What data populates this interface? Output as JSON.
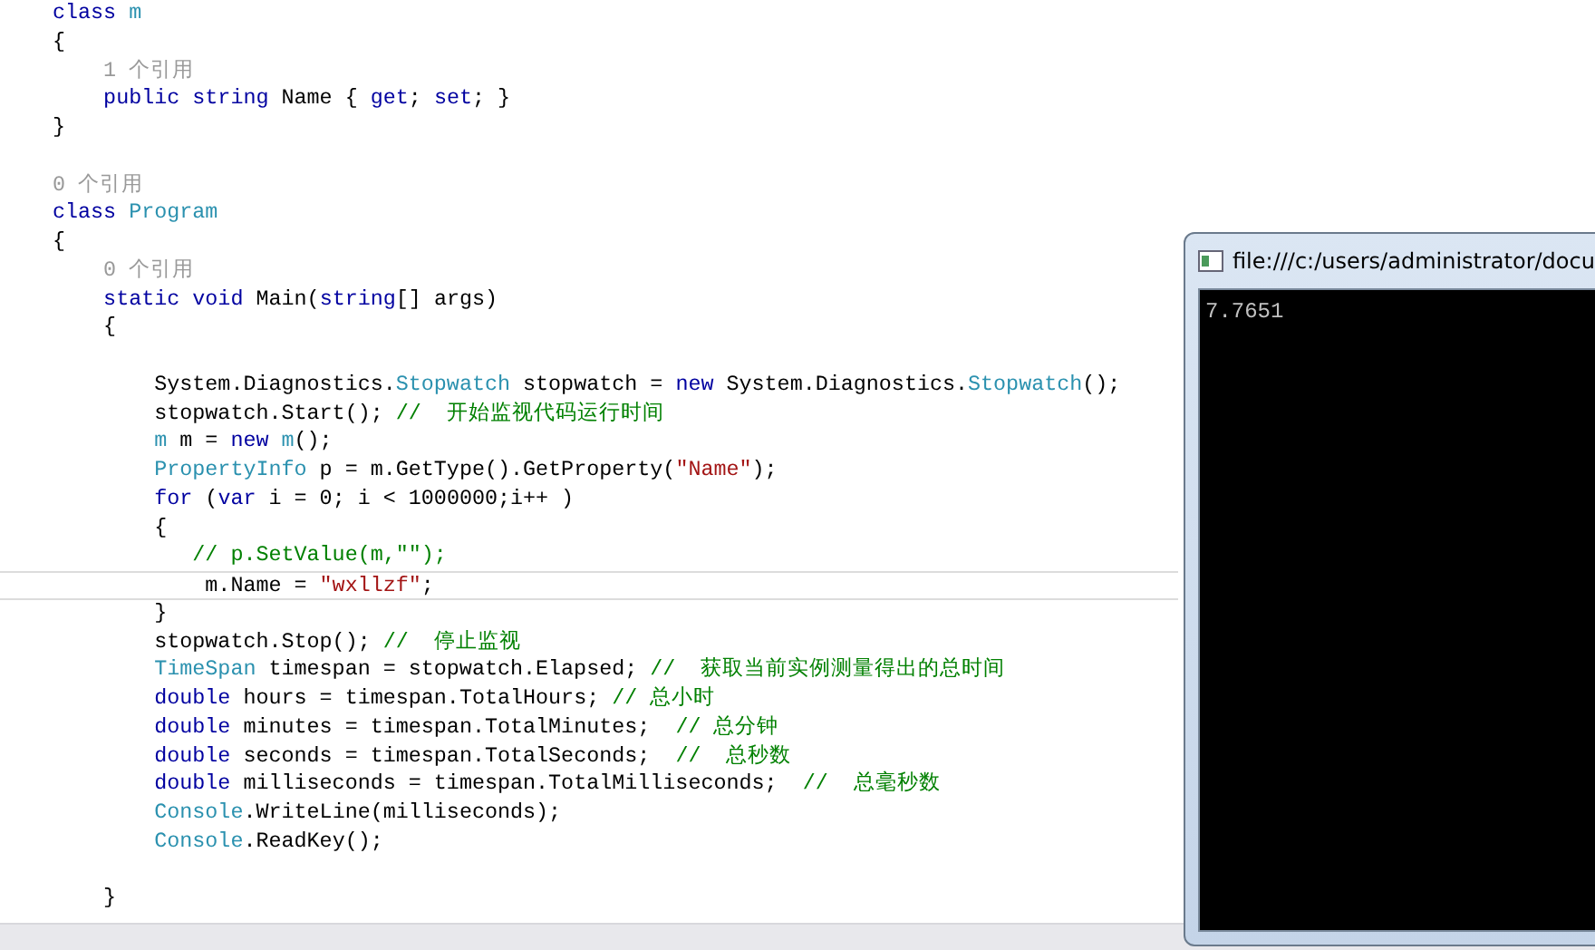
{
  "editor": {
    "lines": [
      {
        "current": false,
        "tokens": [
          {
            "kind": "keyword",
            "text": "class"
          },
          {
            "kind": "type",
            "text": " m"
          }
        ]
      },
      {
        "current": false,
        "tokens": [
          {
            "kind": "plain",
            "text": "{"
          }
        ]
      },
      {
        "current": false,
        "tokens": [
          {
            "kind": "reference",
            "text": "    1 个引用"
          }
        ]
      },
      {
        "current": false,
        "tokens": [
          {
            "kind": "keyword",
            "text": "    public"
          },
          {
            "kind": "keyword",
            "text": " string"
          },
          {
            "kind": "plain",
            "text": " Name { "
          },
          {
            "kind": "keyword",
            "text": "get"
          },
          {
            "kind": "plain",
            "text": "; "
          },
          {
            "kind": "keyword",
            "text": "set"
          },
          {
            "kind": "plain",
            "text": "; }"
          }
        ]
      },
      {
        "current": false,
        "tokens": [
          {
            "kind": "plain",
            "text": "}"
          }
        ]
      },
      {
        "current": false
      },
      {
        "current": false,
        "tokens": [
          {
            "kind": "reference",
            "text": "0 个引用"
          }
        ]
      },
      {
        "current": false,
        "tokens": [
          {
            "kind": "keyword",
            "text": "class"
          },
          {
            "kind": "type",
            "text": " Program"
          }
        ]
      },
      {
        "current": false,
        "tokens": [
          {
            "kind": "plain",
            "text": "{"
          }
        ]
      },
      {
        "current": false,
        "tokens": [
          {
            "kind": "reference",
            "text": "    0 个引用"
          }
        ]
      },
      {
        "current": false,
        "tokens": [
          {
            "kind": "keyword",
            "text": "    static"
          },
          {
            "kind": "keyword",
            "text": " void"
          },
          {
            "kind": "plain",
            "text": " Main("
          },
          {
            "kind": "keyword",
            "text": "string"
          },
          {
            "kind": "plain",
            "text": "[] args)"
          }
        ]
      },
      {
        "current": false,
        "tokens": [
          {
            "kind": "plain",
            "text": "    {"
          }
        ]
      },
      {
        "current": false
      },
      {
        "current": false,
        "tokens": [
          {
            "kind": "plain",
            "text": "        System.Diagnostics."
          },
          {
            "kind": "type",
            "text": "Stopwatch"
          },
          {
            "kind": "plain",
            "text": " stopwatch = "
          },
          {
            "kind": "keyword",
            "text": "new"
          },
          {
            "kind": "plain",
            "text": " System.Diagnostics."
          },
          {
            "kind": "type",
            "text": "Stopwatch"
          },
          {
            "kind": "plain",
            "text": "();"
          }
        ]
      },
      {
        "current": false,
        "tokens": [
          {
            "kind": "plain",
            "text": "        stopwatch.Start(); "
          },
          {
            "kind": "comment",
            "text": "//  开始监视代码运行时间"
          }
        ]
      },
      {
        "current": false,
        "tokens": [
          {
            "kind": "type",
            "text": "        m"
          },
          {
            "kind": "plain",
            "text": " m = "
          },
          {
            "kind": "keyword",
            "text": "new"
          },
          {
            "kind": "type",
            "text": " m"
          },
          {
            "kind": "plain",
            "text": "();"
          }
        ]
      },
      {
        "current": false,
        "tokens": [
          {
            "kind": "type",
            "text": "        PropertyInfo"
          },
          {
            "kind": "plain",
            "text": " p = m.GetType().GetProperty("
          },
          {
            "kind": "string",
            "text": "\"Name\""
          },
          {
            "kind": "plain",
            "text": ");"
          }
        ]
      },
      {
        "current": false,
        "tokens": [
          {
            "kind": "keyword",
            "text": "        for"
          },
          {
            "kind": "plain",
            "text": " ("
          },
          {
            "kind": "keyword",
            "text": "var"
          },
          {
            "kind": "plain",
            "text": " i = 0; i < 1000000;i++ )"
          }
        ]
      },
      {
        "current": false,
        "tokens": [
          {
            "kind": "plain",
            "text": "        {"
          }
        ]
      },
      {
        "current": false,
        "tokens": [
          {
            "kind": "comment",
            "text": "           // p.SetValue(m,\"\");"
          }
        ]
      },
      {
        "current": true,
        "tokens": [
          {
            "kind": "plain",
            "text": "            m.Name = "
          },
          {
            "kind": "string",
            "text": "\"wxllzf\""
          },
          {
            "kind": "plain",
            "text": ";"
          }
        ]
      },
      {
        "current": false,
        "tokens": [
          {
            "kind": "plain",
            "text": "        }"
          }
        ]
      },
      {
        "current": false,
        "tokens": [
          {
            "kind": "plain",
            "text": "        stopwatch.Stop(); "
          },
          {
            "kind": "comment",
            "text": "//  停止监视"
          }
        ]
      },
      {
        "current": false,
        "tokens": [
          {
            "kind": "type",
            "text": "        TimeSpan"
          },
          {
            "kind": "plain",
            "text": " timespan = stopwatch.Elapsed; "
          },
          {
            "kind": "comment",
            "text": "//  获取当前实例测量得出的总时间"
          }
        ]
      },
      {
        "current": false,
        "tokens": [
          {
            "kind": "keyword",
            "text": "        double"
          },
          {
            "kind": "plain",
            "text": " hours = timespan.TotalHours; "
          },
          {
            "kind": "comment",
            "text": "// 总小时"
          }
        ]
      },
      {
        "current": false,
        "tokens": [
          {
            "kind": "keyword",
            "text": "        double"
          },
          {
            "kind": "plain",
            "text": " minutes = timespan.TotalMinutes;  "
          },
          {
            "kind": "comment",
            "text": "// 总分钟"
          }
        ]
      },
      {
        "current": false,
        "tokens": [
          {
            "kind": "keyword",
            "text": "        double"
          },
          {
            "kind": "plain",
            "text": " seconds = timespan.TotalSeconds;  "
          },
          {
            "kind": "comment",
            "text": "//  总秒数"
          }
        ]
      },
      {
        "current": false,
        "tokens": [
          {
            "kind": "keyword",
            "text": "        double"
          },
          {
            "kind": "plain",
            "text": " milliseconds = timespan.TotalMilliseconds;  "
          },
          {
            "kind": "comment",
            "text": "//  总毫秒数"
          }
        ]
      },
      {
        "current": false,
        "tokens": [
          {
            "kind": "type",
            "text": "        Console"
          },
          {
            "kind": "plain",
            "text": ".WriteLine(milliseconds);"
          }
        ]
      },
      {
        "current": false,
        "tokens": [
          {
            "kind": "type",
            "text": "        Console"
          },
          {
            "kind": "plain",
            "text": ".ReadKey();"
          }
        ]
      },
      {
        "current": false
      },
      {
        "current": false,
        "tokens": [
          {
            "kind": "plain",
            "text": "    }"
          }
        ]
      }
    ]
  },
  "console": {
    "title": "file:///c:/users/administrator/docu",
    "output": "7.7651"
  }
}
